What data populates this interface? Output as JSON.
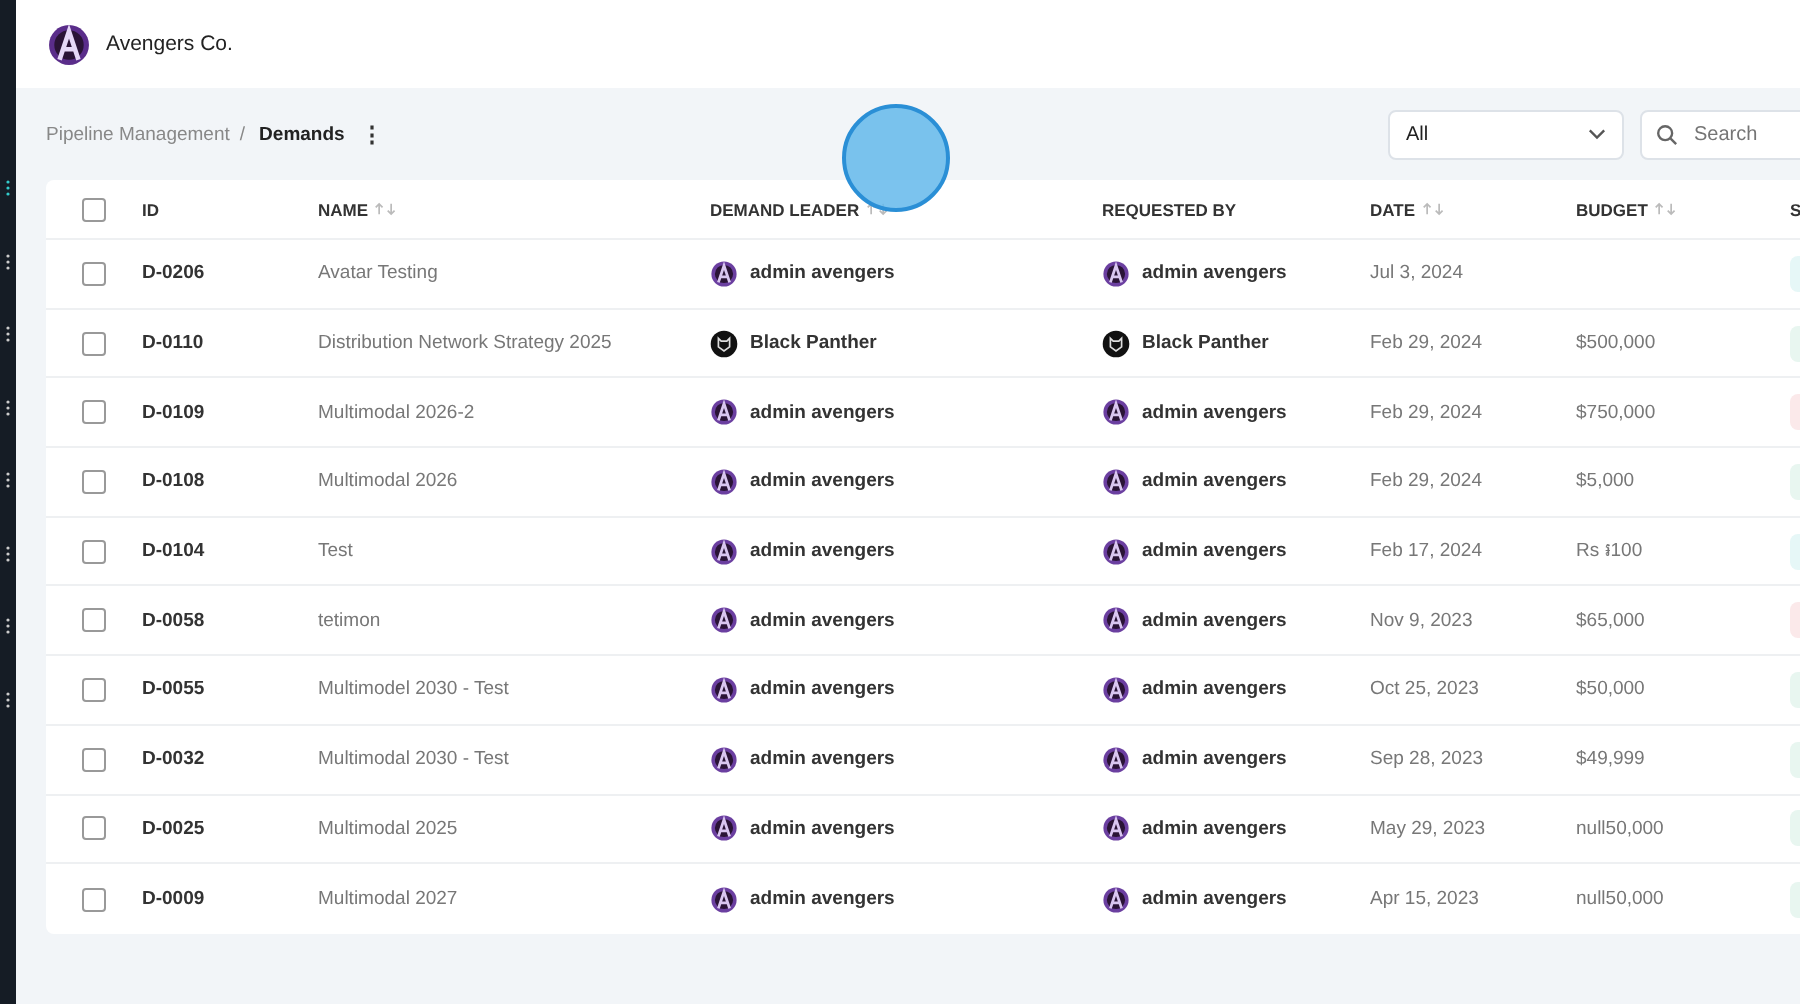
{
  "app": {
    "name": "Avengers Co."
  },
  "breadcrumb": {
    "parent": "Pipeline Management",
    "separator": "/",
    "current": "Demands",
    "menu_icon": "⋮"
  },
  "filter": {
    "value": "All"
  },
  "search": {
    "placeholder": "Search"
  },
  "table": {
    "columns": [
      {
        "label": "ID",
        "sortable": false
      },
      {
        "label": "NAME",
        "sortable": true
      },
      {
        "label": "DEMAND LEADER",
        "sortable": true
      },
      {
        "label": "REQUESTED BY",
        "sortable": false
      },
      {
        "label": "DATE",
        "sortable": true
      },
      {
        "label": "BUDGET",
        "sortable": true
      },
      {
        "label": "S"
      }
    ],
    "select_all": {
      "checked": false
    },
    "rows": [
      {
        "id": "D-0206",
        "name": "Avatar Testing",
        "leader": {
          "name": "admin avengers",
          "kind": "avengers"
        },
        "requested_by": {
          "name": "admin avengers",
          "kind": "avengers"
        },
        "date": "Jul 3, 2024",
        "checked": false,
        "color": "#e6f7f7"
      },
      {
        "id": "D-0110",
        "name": "Distribution Network Strategy 2025",
        "leader": {
          "name": "Black Panther",
          "kind": "panther"
        },
        "requested_by": {
          "name": "Black Panther",
          "kind": "panther"
        },
        "date": "Feb 29, 2024",
        "budget": "$500,000",
        "checked": false,
        "color": "#e8f6f0"
      },
      {
        "id": "D-0109",
        "name": "Multimodal 2026-2",
        "leader": {
          "name": "admin avengers",
          "kind": "avengers"
        },
        "requested_by": {
          "name": "admin avengers",
          "kind": "avengers"
        },
        "date": "Feb 29, 2024",
        "budget": "$750,000",
        "checked": false,
        "color": "#fbe9ea"
      },
      {
        "id": "D-0108",
        "name": "Multimodal 2026",
        "leader": {
          "name": "admin avengers",
          "kind": "avengers"
        },
        "requested_by": {
          "name": "admin avengers",
          "kind": "avengers"
        },
        "date": "Feb 29, 2024",
        "budget": "$5,000",
        "checked": false,
        "color": "#e8f6f0"
      },
      {
        "id": "D-0104",
        "name": "Test",
        "leader": {
          "name": "admin avengers",
          "kind": "avengers"
        },
        "requested_by": {
          "name": "admin avengers",
          "kind": "avengers"
        },
        "date": "Feb 17, 2024",
        "budget": "Rs ៛100",
        "checked": false,
        "color": "#e6f7f7"
      },
      {
        "id": "D-0058",
        "name": "tetimon",
        "leader": {
          "name": "admin avengers",
          "kind": "avengers"
        },
        "requested_by": {
          "name": "admin avengers",
          "kind": "avengers"
        },
        "date": "Nov 9, 2023",
        "budget": "$65,000",
        "checked": false,
        "color": "#fbe9ea"
      },
      {
        "id": "D-0055",
        "name": "Multimodel 2030 - Test",
        "leader": {
          "name": "admin avengers",
          "kind": "avengers"
        },
        "requested_by": {
          "name": "admin avengers",
          "kind": "avengers"
        },
        "date": "Oct 25, 2023",
        "budget": "$50,000",
        "checked": false,
        "color": "#e8f6f0"
      },
      {
        "id": "D-0032",
        "name": "Multimodal 2030 - Test",
        "leader": {
          "name": "admin avengers",
          "kind": "avengers"
        },
        "requested_by": {
          "name": "admin avengers",
          "kind": "avengers"
        },
        "date": "Sep 28, 2023",
        "budget": "$49,999",
        "checked": false,
        "color": "#e8f6f0"
      },
      {
        "id": "D-0025",
        "name": "Multimodal 2025",
        "leader": {
          "name": "admin avengers",
          "kind": "avengers"
        },
        "requested_by": {
          "name": "admin avengers",
          "kind": "avengers"
        },
        "date": "May 29, 2023",
        "budget": "null50,000",
        "checked": false,
        "color": "#e8f6f0"
      },
      {
        "id": "D-0009",
        "name": "Multimodal 2027",
        "leader": {
          "name": "admin avengers",
          "kind": "avengers"
        },
        "requested_by": {
          "name": "admin avengers",
          "kind": "avengers"
        },
        "date": "Apr 15, 2023",
        "budget": "null50,000",
        "checked": false,
        "color": "#e8f6f0"
      }
    ]
  }
}
